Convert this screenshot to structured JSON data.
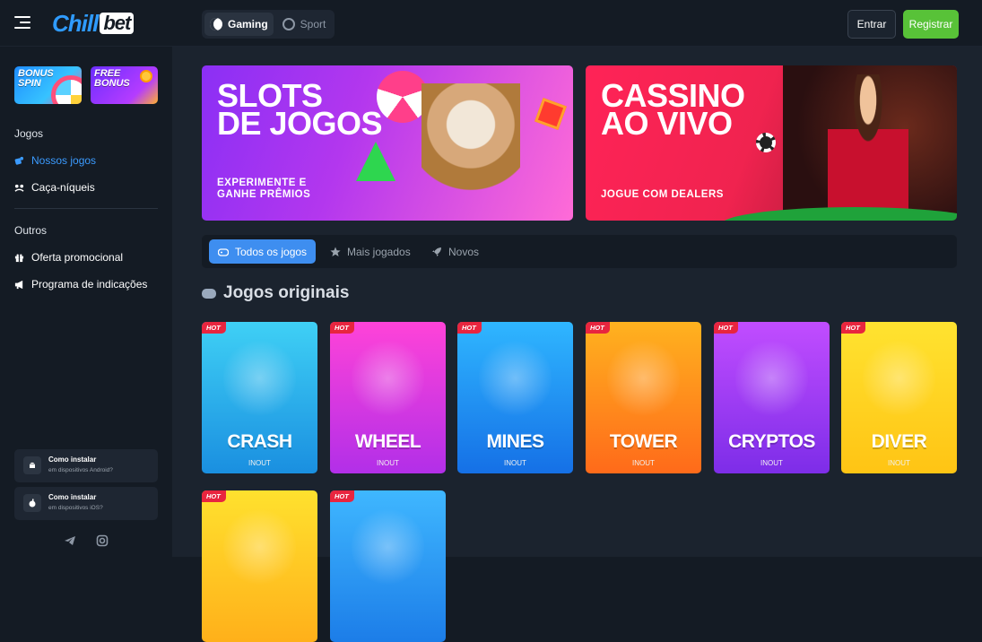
{
  "header": {
    "logo_part1": "Chill",
    "logo_part2": "bet",
    "mode_tabs": [
      {
        "label": "Gaming",
        "active": true
      },
      {
        "label": "Sport",
        "active": false
      }
    ],
    "login_label": "Entrar",
    "register_label": "Registrar"
  },
  "sidebar": {
    "promos": [
      {
        "label": "BONUS SPIN",
        "line1": "BONUS",
        "line2": "SPIN"
      },
      {
        "label": "FREE BONUS",
        "line1": "FREE",
        "line2": "BONUS"
      }
    ],
    "section_games": "Jogos",
    "games_items": [
      {
        "label": "Nossos jogos",
        "icon": "dice-icon",
        "active": true
      },
      {
        "label": "Caça-níqueis",
        "icon": "slots-icon",
        "active": false
      }
    ],
    "section_other": "Outros",
    "other_items": [
      {
        "label": "Oferta promocional",
        "icon": "gift-icon"
      },
      {
        "label": "Programa de indicações",
        "icon": "megaphone-icon"
      }
    ],
    "install": [
      {
        "title": "Como instalar",
        "subtitle": "em dispositivos Android?",
        "icon": "android-icon"
      },
      {
        "title": "Como instalar",
        "subtitle": "em dispositivos iOS?",
        "icon": "apple-icon"
      }
    ],
    "social": [
      "telegram-icon",
      "instagram-icon"
    ]
  },
  "banners": [
    {
      "title_line1": "SLOTS",
      "title_line2": "DE JOGOS",
      "subtitle_line1": "EXPERIMENTE E",
      "subtitle_line2": "GANHE PRÊMIOS"
    },
    {
      "title_line1": "CASSINO",
      "title_line2": "AO VIVO",
      "subtitle_line1": "JOGUE COM DEALERS",
      "subtitle_line2": ""
    }
  ],
  "game_tabs": [
    {
      "label": "Todos os jogos",
      "icon": "gamepad-icon",
      "active": true
    },
    {
      "label": "Mais jogados",
      "icon": "star-icon",
      "active": false
    },
    {
      "label": "Novos",
      "icon": "rocket-icon",
      "active": false
    }
  ],
  "section_title": "Jogos originais",
  "games": [
    {
      "name": "CRASH",
      "provider": "INOUT",
      "badge": "HOT",
      "color_top": "#3fd0f5",
      "color_bottom": "#1a8fe0"
    },
    {
      "name": "WHEEL",
      "provider": "INOUT",
      "badge": "HOT",
      "color_top": "#ff43d8",
      "color_bottom": "#b22fe8"
    },
    {
      "name": "MINES",
      "provider": "INOUT",
      "badge": "HOT",
      "color_top": "#2fb6ff",
      "color_bottom": "#1570e6"
    },
    {
      "name": "TOWER",
      "provider": "INOUT",
      "badge": "HOT",
      "color_top": "#ffb21f",
      "color_bottom": "#ff6a1a"
    },
    {
      "name": "CRYPTOS",
      "provider": "INOUT",
      "badge": "HOT",
      "color_top": "#c14dff",
      "color_bottom": "#7d2de8"
    },
    {
      "name": "DIVER",
      "provider": "INOUT",
      "badge": "HOT",
      "color_top": "#ffe330",
      "color_bottom": "#ffc414"
    },
    {
      "name": "",
      "provider": "",
      "badge": "HOT",
      "color_top": "#ffe12e",
      "color_bottom": "#ffb01a"
    },
    {
      "name": "",
      "provider": "",
      "badge": "HOT",
      "color_top": "#3fb7ff",
      "color_bottom": "#1c7de8"
    }
  ]
}
